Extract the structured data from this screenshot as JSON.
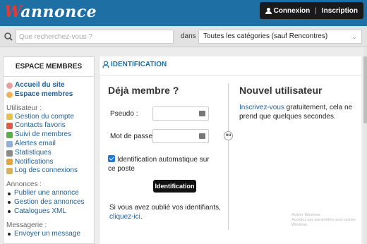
{
  "header": {
    "logo_first": "W",
    "logo_rest": "annonce",
    "connexion": "Connexion",
    "separator": "|",
    "inscription": "Inscription"
  },
  "search": {
    "placeholder": "Que recherchez-vous ?",
    "in_label": "dans",
    "category": "Toutes les catégories (sauf Rencontres)"
  },
  "sidebar": {
    "title": "ESPACE MEMBRES",
    "home": "Accueil du site",
    "members": "Espace membres",
    "user_section": "Utilisateur :",
    "user_items": [
      "Gestion du compte",
      "Contacts favoris",
      "Suivi de membres",
      "Alertes email",
      "Statistiques",
      "Notifications",
      "Log des connexions"
    ],
    "ads_section": "Annonces :",
    "ads_items": [
      "Publier une annonce",
      "Gestion des annonces",
      "Catalogues XML"
    ],
    "msg_section": "Messagerie :",
    "msg_items": [
      "Envoyer un message"
    ]
  },
  "main": {
    "section_title": "IDENTIFICATION",
    "login_title": "Déjà membre ?",
    "pseudo_label": "Pseudo :",
    "password_label": "Mot de passe :",
    "auto_label": "Identification automatique sur ce poste",
    "auto_checked": true,
    "submit": "Identification",
    "forgot_text": "Si vous avez oublié vos identifiants,",
    "forgot_link": "cliquez-ici",
    "forgot_end": ".",
    "or_label": "ou",
    "new_title": "Nouvel utilisateur",
    "register_link": "Inscrivez-vous",
    "register_text": " gratuitement, cela ne prend que quelques secondes.",
    "watermark_line1": "Activer Windows",
    "watermark_line2": "Accédez aux paramètres pour activer Windows."
  },
  "colors": {
    "header": "#1d6fa4",
    "accent": "#1d5f99",
    "button": "#111111"
  }
}
